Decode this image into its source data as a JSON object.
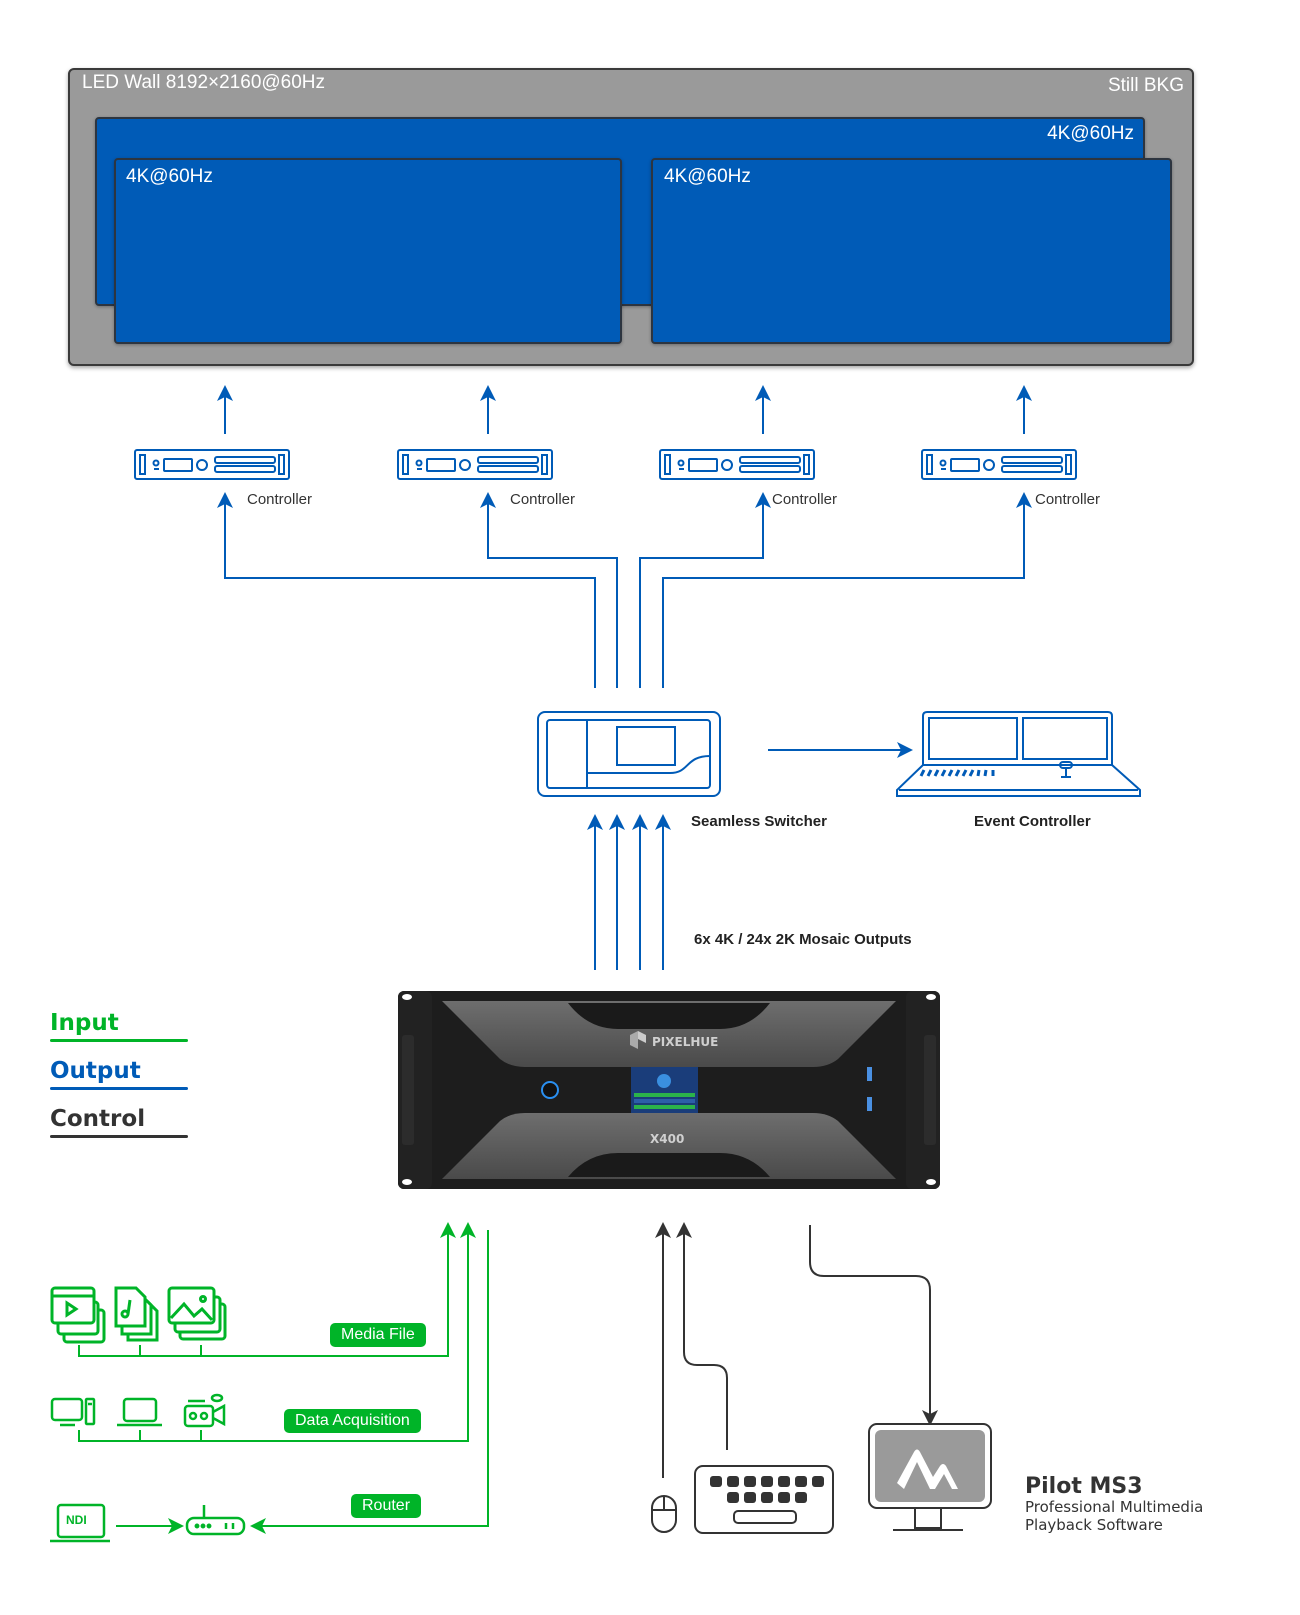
{
  "colors": {
    "input": "#00b428",
    "output": "#005bb7",
    "control": "#333333",
    "wall_bg": "#9a9a9a",
    "panel": "#005bb7"
  },
  "led_wall": {
    "title": "LED Wall 8192×2160@60Hz",
    "background_label": "Still BKG",
    "layers": [
      {
        "label": "4K@60Hz"
      },
      {
        "label": "4K@60Hz"
      },
      {
        "label": "4K@60Hz"
      }
    ]
  },
  "controllers": [
    {
      "label": "Controller",
      "icon": "controller-icon"
    },
    {
      "label": "Controller",
      "icon": "controller-icon"
    },
    {
      "label": "Controller",
      "icon": "controller-icon"
    },
    {
      "label": "Controller",
      "icon": "controller-icon"
    }
  ],
  "switcher": {
    "label": "Seamless Switcher",
    "icon": "seamless-switcher-icon"
  },
  "event_controller": {
    "label": "Event Controller",
    "icon": "event-controller-icon"
  },
  "outputs_label": "6x 4K / 24x 2K Mosaic Outputs",
  "device": {
    "brand": "PIXELHUE",
    "model": "X400"
  },
  "legend": [
    {
      "label": "Input",
      "color": "#00b428"
    },
    {
      "label": "Output",
      "color": "#005bb7"
    },
    {
      "label": "Control",
      "color": "#333333"
    }
  ],
  "inputs": {
    "media_file": {
      "label": "Media File",
      "icons": [
        "video-file-icon",
        "audio-file-icon",
        "image-file-icon"
      ]
    },
    "data_acquisition": {
      "label": "Data Acquisition",
      "icons": [
        "desktop-pc-icon",
        "laptop-icon",
        "camera-icon"
      ]
    },
    "router": {
      "label": "Router",
      "source_label": "NDI",
      "icons": [
        "ndi-laptop-icon",
        "router-icon"
      ]
    }
  },
  "control": {
    "icons": [
      "mouse-icon",
      "keyboard-icon",
      "monitor-icon"
    ]
  },
  "pilot": {
    "title": "Pilot MS3",
    "subtitle_line1": "Professional Multimedia",
    "subtitle_line2": "Playback Software"
  }
}
